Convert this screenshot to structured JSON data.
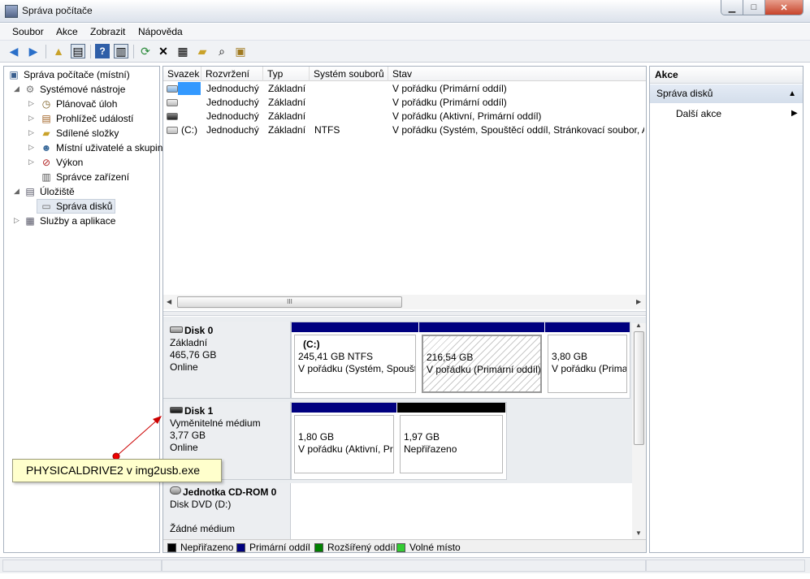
{
  "window": {
    "title": "Správa počítače",
    "minimize": "▁",
    "maximize": "□",
    "close": "✕"
  },
  "menu": [
    "Soubor",
    "Akce",
    "Zobrazit",
    "Nápověda"
  ],
  "toolbar": {
    "icons": [
      "back-icon",
      "forward-icon",
      "up-folder-icon",
      "show-hide-tree-icon",
      "help-icon",
      "show-hide-action-icon",
      "refresh-icon",
      "delete-icon",
      "properties-icon",
      "open-icon",
      "search-icon",
      "wizard-icon"
    ]
  },
  "tree": {
    "root": "Správa počítače (místní)",
    "system_tools": "Systémové nástroje",
    "task_scheduler": "Plánovač úloh",
    "event_viewer": "Prohlížeč událostí",
    "shared_folders": "Sdílené složky",
    "local_users": "Místní uživatelé a skupiny",
    "performance": "Výkon",
    "device_manager": "Správce zařízení",
    "storage": "Úložiště",
    "disk_management": "Správa disků",
    "services": "Služby a aplikace"
  },
  "volumes": {
    "columns": [
      "Svazek",
      "Rozvržení",
      "Typ",
      "Systém souborů",
      "Stav"
    ],
    "rows": [
      {
        "volume": "",
        "layout": "Jednoduchý",
        "type": "Základní",
        "fs": "",
        "status": "V pořádku (Primární oddíl)"
      },
      {
        "volume": "",
        "layout": "Jednoduchý",
        "type": "Základní",
        "fs": "",
        "status": "V pořádku (Primární oddíl)"
      },
      {
        "volume": "",
        "layout": "Jednoduchý",
        "type": "Základní",
        "fs": "",
        "status": "V pořádku (Aktivní, Primární oddíl)"
      },
      {
        "volume": "(C:)",
        "layout": "Jednoduchý",
        "type": "Základní",
        "fs": "NTFS",
        "status": "V pořádku (Systém, Spouštěcí oddíl, Stránkovací soubor, Ak"
      }
    ],
    "scroll_grip": "III"
  },
  "disks": [
    {
      "name": "Disk 0",
      "type": "Základní",
      "size": "465,76 GB",
      "state": "Online",
      "partitions": [
        {
          "label": "(C:)",
          "size": "245,41 GB NTFS",
          "status": "V pořádku (Systém, Spoušt"
        },
        {
          "label": "",
          "size": "216,54 GB",
          "status": "V pořádku (Primární oddíl)"
        },
        {
          "label": "",
          "size": "3,80 GB",
          "status": "V pořádku (Prima"
        }
      ]
    },
    {
      "name": "Disk 1",
      "type": "Vyměnitelné médium",
      "size": "3,77 GB",
      "state": "Online",
      "partitions": [
        {
          "label": "",
          "size": "1,80 GB",
          "status": "V pořádku (Aktivní, Pr"
        },
        {
          "label": "",
          "size": "1,97 GB",
          "status": "Nepřiřazeno"
        }
      ]
    },
    {
      "name": "Jednotka CD-ROM 0",
      "type": "Disk DVD (D:)",
      "size": "",
      "state": "Žádné médium",
      "partitions": []
    }
  ],
  "legend": [
    {
      "label": "Nepřiřazeno",
      "color": "#000000"
    },
    {
      "label": "Primární oddíl",
      "color": "#00007f"
    },
    {
      "label": "Rozšířený oddíl",
      "color": "#008000"
    },
    {
      "label": "Volné místo",
      "color": "#33cc33"
    }
  ],
  "actions": {
    "header": "Akce",
    "section": "Správa disků",
    "more": "Další akce"
  },
  "callout": {
    "text": "PHYSICALDRIVE2 v img2usb.exe"
  }
}
